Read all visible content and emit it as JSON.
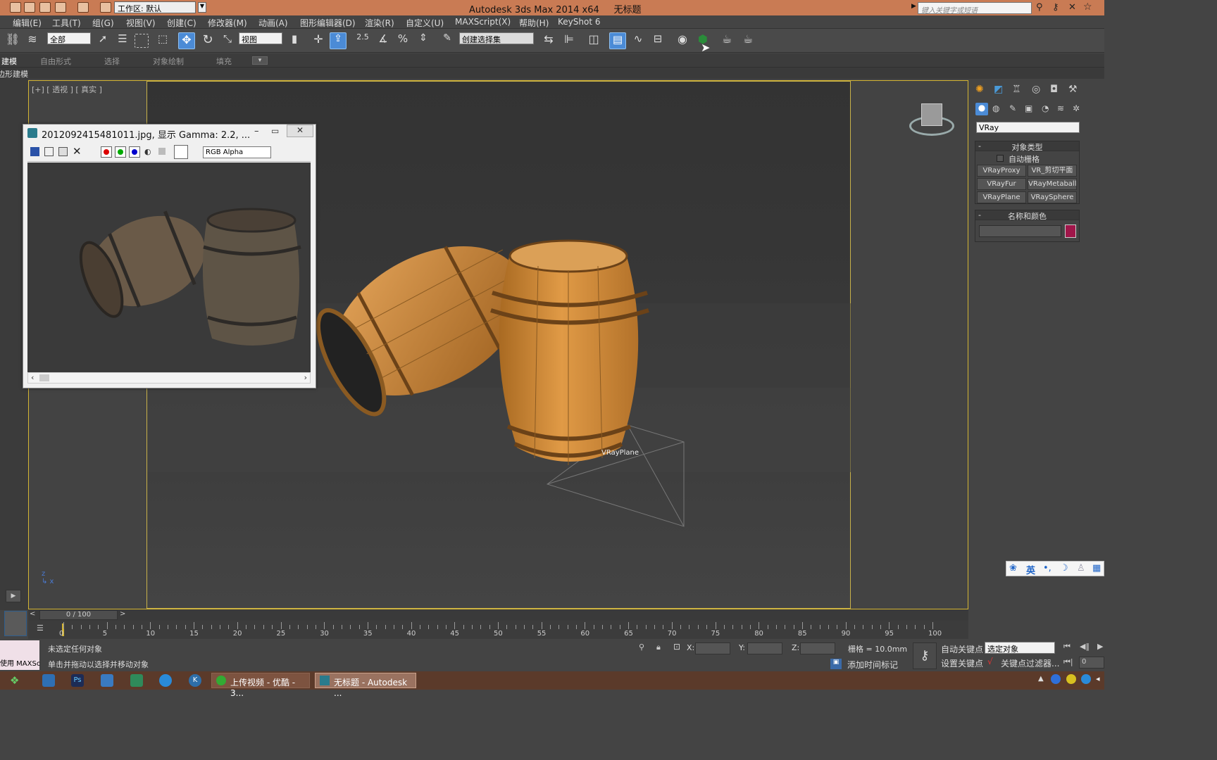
{
  "titlebar": {
    "workspace": "工作区: 默认",
    "app_title": "Autodesk 3ds Max  2014 x64",
    "doc_title": "无标题",
    "search_placeholder": "键入关键字或短语"
  },
  "menu": [
    "编辑(E)",
    "工具(T)",
    "组(G)",
    "视图(V)",
    "创建(C)",
    "修改器(M)",
    "动画(A)",
    "图形编辑器(D)",
    "渲染(R)",
    "自定义(U)",
    "MAXScript(X)",
    "帮助(H)",
    "KeyShot 6"
  ],
  "toolbar": {
    "filter_value": "全部",
    "ref_coord_value": "视图",
    "snap_label": "2.5",
    "named_sel_value": "创建选择集"
  },
  "ribbon": {
    "tabs": [
      "建模",
      "自由形式",
      "选择",
      "对象绘制",
      "填充"
    ],
    "sublabel": "多边形建模"
  },
  "viewport": {
    "label": "[+] [ 透视 ] [ 真实 ]",
    "object_label": "VRayPlane"
  },
  "image_window": {
    "title": "2012092415481011.jpg, 显示 Gamma: 2.2, ...",
    "channel_value": "RGB Alpha"
  },
  "command_panel": {
    "renderer_value": "VRay",
    "object_type_title": "对象类型",
    "autogrid_label": "自动栅格",
    "buttons": [
      "VRayProxy",
      "VR_剪切平面",
      "VRayFur",
      "VRayMetaball",
      "VRayPlane",
      "VRaySphere"
    ],
    "name_color_title": "名称和颜色",
    "object_color": "#a0164a"
  },
  "ime": {
    "lang": "英"
  },
  "timeline": {
    "frame_label": "0 / 100",
    "ticks": [
      "0",
      "5",
      "10",
      "15",
      "20",
      "25",
      "30",
      "35",
      "40",
      "45",
      "50",
      "55",
      "60",
      "65",
      "70",
      "75",
      "80",
      "85",
      "90",
      "95",
      "100"
    ]
  },
  "status": {
    "maxscript_label": "使用 MAXSc",
    "selection_text": "未选定任何对象",
    "prompt_text": "单击并拖动以选择并移动对象",
    "x_label": "X:",
    "y_label": "Y:",
    "z_label": "Z:",
    "grid_text": "栅格 = 10.0mm",
    "add_time_tag": "添加时间标记",
    "auto_key": "自动关键点",
    "set_key": "设置关键点",
    "key_mode_value": "选定对象",
    "key_filters": "关键点过滤器...",
    "frame_value": "0"
  },
  "taskbar": {
    "tasks": [
      "上传视频 - 优酷 - 3...",
      "无标题 - Autodesk ..."
    ]
  }
}
